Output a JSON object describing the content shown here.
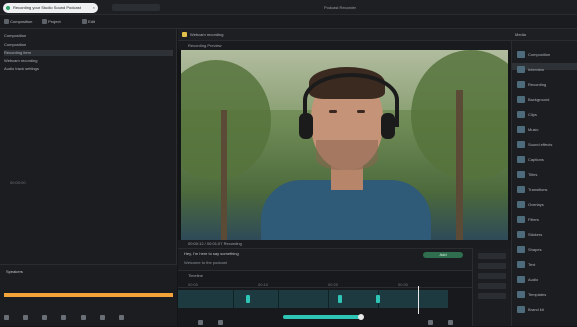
{
  "browser": {
    "tab_title": "Recording your Studio Sound Podcast",
    "window_title": "Podcast Recorder"
  },
  "toolbar": {
    "items": [
      "Composition",
      "Project",
      "Edit"
    ]
  },
  "left_panel": {
    "title": "Composition",
    "tree": [
      "Composition",
      "Recording item",
      "Webcam recording",
      "Audio track settings"
    ],
    "timestamp": "00:00:00",
    "section_label": "Speakers",
    "progress": 1.0
  },
  "preview": {
    "header": "Webcam recording",
    "sub": "Recording Preview",
    "footer": "00:00:12 / 00:01:07 Recording",
    "background_colors": {
      "shirt": "#2f5a78",
      "foliage": "#56733c"
    }
  },
  "script": {
    "line1": "Hey, I'm here to say something",
    "line2": "Welcome to the podcast",
    "pill": "Add"
  },
  "timeline": {
    "head": "Timeline",
    "ruler": [
      "00:00",
      "00:10",
      "00:20",
      "00:30"
    ]
  },
  "right_panel": {
    "header": "Media",
    "items": [
      "Composition",
      "Interview",
      "Recording",
      "Background",
      "Clips",
      "Music",
      "Sound effects",
      "Captions",
      "Titles",
      "Transitions",
      "Overlays",
      "Filters",
      "Stickers",
      "Shapes",
      "Text",
      "Audio",
      "Templates",
      "Brand kit"
    ]
  }
}
